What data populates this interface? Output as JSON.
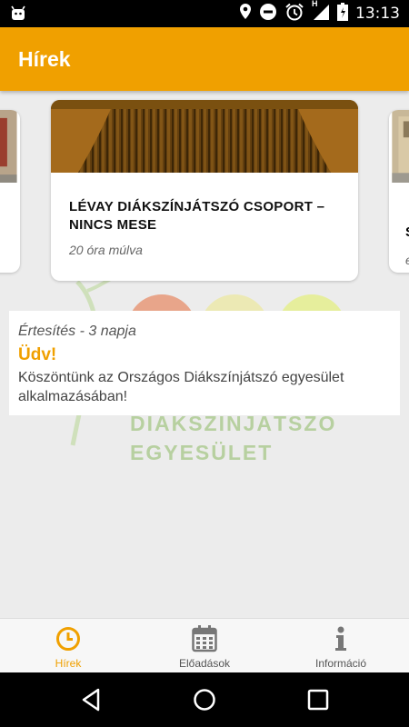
{
  "status_bar": {
    "time": "13:13",
    "network_label": "H",
    "icons": [
      "android-icon",
      "location-icon",
      "dnd-icon",
      "alarm-icon",
      "signal-icon",
      "battery-icon"
    ]
  },
  "app_bar": {
    "title": "Hírek"
  },
  "carousel": {
    "main_card": {
      "title": "LÉVAY DIÁKSZÍNJÁTSZÓ CSOPORT – NINCS MESE",
      "time": "20 óra múlva"
    },
    "right_card": {
      "title_fragment": "S",
      "time_fragment": "e"
    }
  },
  "background": {
    "logo_line1": "DIÁKSZÍNJÁTSZÓ",
    "logo_line2": "EGYESÜLET"
  },
  "notification": {
    "meta": "Értesítés - 3 napja",
    "title": "Üdv!",
    "body": "Köszöntünk az Országos Diákszínjátszó egyesület alkalmazásában!"
  },
  "bottom_nav": {
    "items": [
      {
        "label": "Hírek",
        "icon": "clock-icon",
        "active": true
      },
      {
        "label": "Előadások",
        "icon": "calendar-icon",
        "active": false
      },
      {
        "label": "Információ",
        "icon": "info-icon",
        "active": false
      }
    ]
  },
  "colors": {
    "accent": "#f0a000",
    "logo_green": "#b7d0a0"
  }
}
